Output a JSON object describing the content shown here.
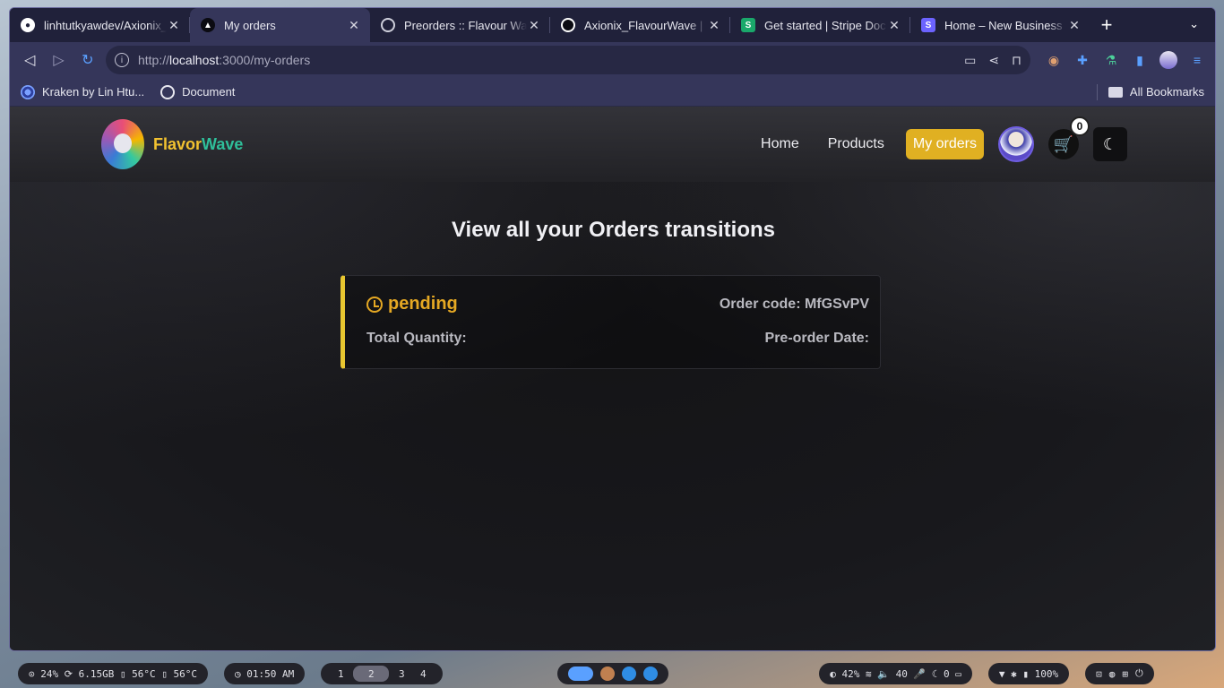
{
  "tabs": [
    {
      "title": "linhtutkyawdev/Axionix_",
      "favicon": "github-icon",
      "active": false
    },
    {
      "title": "My orders",
      "favicon": "triangle-icon",
      "active": true
    },
    {
      "title": "Preorders :: Flavour Wa",
      "favicon": "globe-icon",
      "active": false
    },
    {
      "title": "Axionix_FlavourWave |",
      "favicon": "axionix-icon",
      "active": false
    },
    {
      "title": "Get started | Stripe Doc",
      "favicon": "stripe-icon",
      "active": false
    },
    {
      "title": "Home – New Business",
      "favicon": "square-s-icon",
      "active": false
    }
  ],
  "toolbar": {
    "url_prefix": "http://",
    "url_host": "localhost",
    "url_rest": ":3000/my-orders"
  },
  "bookmarks": {
    "items": [
      {
        "label": "Kraken by Lin Htu..."
      },
      {
        "label": "Document"
      }
    ],
    "all_label": "All Bookmarks"
  },
  "site": {
    "brand_part1": "Flavor",
    "brand_part2": "Wave",
    "nav": [
      {
        "label": "Home",
        "active": false
      },
      {
        "label": "Products",
        "active": false
      },
      {
        "label": "My orders",
        "active": true
      }
    ],
    "cart_count": "0"
  },
  "main": {
    "heading": "View all your Orders transitions",
    "order": {
      "status": "pending",
      "order_code_label": "Order code: MfGSvPV",
      "total_quantity_label": "Total Quantity:",
      "preorder_date_label": "Pre-order Date:"
    }
  },
  "taskbar": {
    "stats": "⊙ 24%  ⟳ 6.15GB  ▯ 56°C  ▯ 56°C",
    "clock": "◷ 01:50 AM",
    "workspaces": [
      "1",
      "2",
      "3",
      "4"
    ],
    "active_workspace": "2",
    "system": "◐ 42%  ≋  🔈 40  🎤 ☾ 0  ▭",
    "battery": "▼  ✱  ▮ 100%"
  },
  "colors": {
    "accent": "#e0b022",
    "pending": "#e5a823",
    "brand_yellow": "#f2c230",
    "brand_green": "#2fbf9a"
  }
}
